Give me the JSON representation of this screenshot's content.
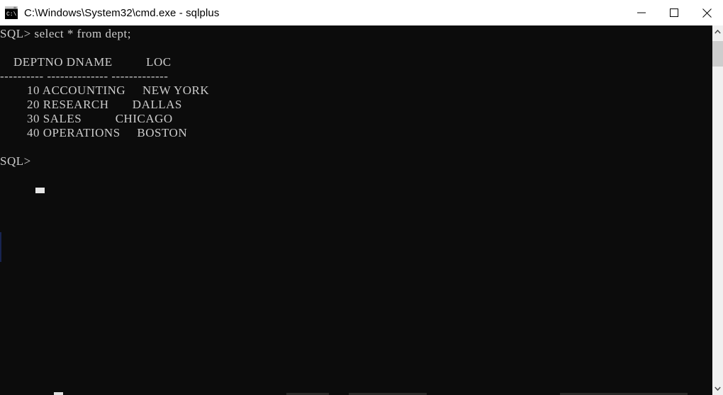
{
  "window": {
    "title": "C:\\Windows\\System32\\cmd.exe - sqlplus",
    "app_icon": "cmd-console-icon",
    "titlebar_bg": "#ffffff",
    "title_color": "#000000"
  },
  "controls": {
    "minimize_label": "Minimize",
    "maximize_label": "Maximize",
    "close_label": "Close"
  },
  "terminal": {
    "background": "#0c0c0c",
    "foreground": "#cccccc",
    "prompt": "SQL>",
    "command": "select * from dept;",
    "cursor_visible": true,
    "columns": [
      "DEPTNO",
      "DNAME",
      "LOC"
    ],
    "separator": [
      "----------",
      "--------------",
      "-------------"
    ],
    "rows": [
      {
        "deptno": "10",
        "dname": "ACCOUNTING",
        "loc": "NEW YORK"
      },
      {
        "deptno": "20",
        "dname": "RESEARCH",
        "loc": "DALLAS"
      },
      {
        "deptno": "30",
        "dname": "SALES",
        "loc": "CHICAGO"
      },
      {
        "deptno": "40",
        "dname": "OPERATIONS",
        "loc": "BOSTON"
      }
    ],
    "trailing_prompt": "SQL>",
    "screen_text": "SQL> select * from dept;\n\n    DEPTNO DNAME          LOC\n---------- -------------- -------------\n        10 ACCOUNTING     NEW YORK\n        20 RESEARCH       DALLAS\n        30 SALES          CHICAGO\n        40 OPERATIONS     BOSTON\n\nSQL>"
  },
  "scrollbar": {
    "up_arrow": "chevron-up-icon",
    "down_arrow": "chevron-down-icon",
    "thumb_color": "#cdcdcd",
    "track_color": "#f0f0f0"
  }
}
